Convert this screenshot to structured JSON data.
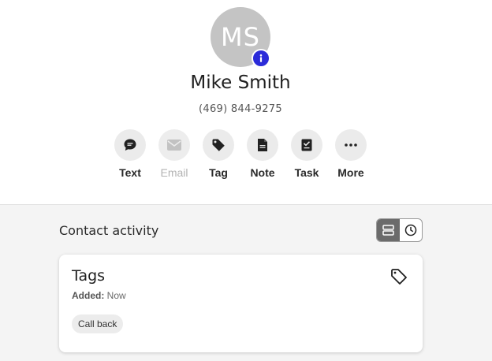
{
  "contact": {
    "initials": "MS",
    "name": "Mike Smith",
    "phone": "(469) 844-9275",
    "info_icon": "info-icon",
    "avatar_color": "#c4c4c4",
    "badge_color": "#2b2bd9"
  },
  "actions": [
    {
      "label": "Text",
      "icon": "chat-bubble-icon",
      "disabled": false
    },
    {
      "label": "Email",
      "icon": "envelope-icon",
      "disabled": true
    },
    {
      "label": "Tag",
      "icon": "tag-icon",
      "disabled": false
    },
    {
      "label": "Note",
      "icon": "document-icon",
      "disabled": false
    },
    {
      "label": "Task",
      "icon": "task-icon",
      "disabled": false
    },
    {
      "label": "More",
      "icon": "ellipsis-icon",
      "disabled": false
    }
  ],
  "activity": {
    "title": "Contact activity",
    "view_toggle": {
      "options": [
        "list-view-icon",
        "clock-icon"
      ],
      "selected": "list-view-icon"
    }
  },
  "tags_card": {
    "title": "Tags",
    "added_label": "Added:",
    "added_value": "Now",
    "icon": "tag-outline-icon",
    "tags": [
      "Call back"
    ]
  }
}
